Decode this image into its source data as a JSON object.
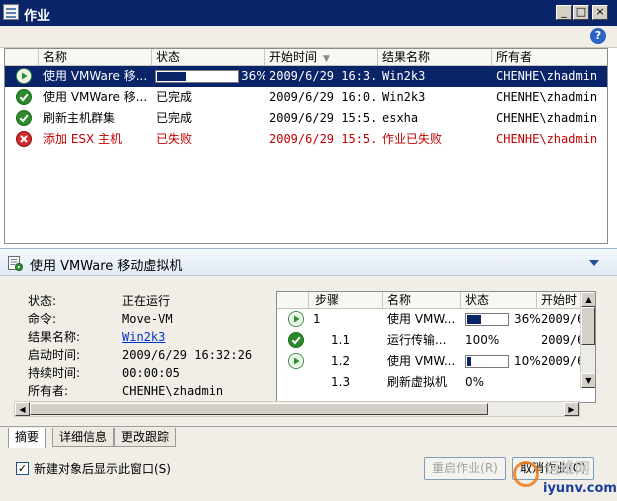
{
  "window": {
    "title": "作业",
    "controls": [
      "_",
      "□",
      "×"
    ]
  },
  "help_icon": "?",
  "job_list": {
    "columns": [
      "名称",
      "状态",
      "开始时间",
      "结果名称",
      "所有者"
    ],
    "rows": [
      {
        "icon": "running",
        "name": "使用 VMWare 移...",
        "status": "",
        "progress": "36%",
        "progress_fraction": 0.36,
        "start": "2009/6/29 16:3...",
        "result": "Win2k3",
        "owner": "CHENHE\\zhadmin"
      },
      {
        "icon": "ok",
        "name": "使用 VMWare 移...",
        "status": "已完成",
        "start": "2009/6/29 16:0...",
        "result": "Win2k3",
        "owner": "CHENHE\\zhadmin"
      },
      {
        "icon": "ok",
        "name": "刷新主机群集",
        "status": "已完成",
        "start": "2009/6/29 15:5...",
        "result": "esxha",
        "owner": "CHENHE\\zhadmin"
      },
      {
        "icon": "error",
        "name": "添加 ESX 主机",
        "status": "已失败",
        "start": "2009/6/29 15:5...",
        "result": "作业已失败",
        "owner": "CHENHE\\zhadmin"
      }
    ]
  },
  "detail": {
    "title": "使用 VMWare 移动虚拟机",
    "fields": [
      {
        "label": "状态:",
        "value": "正在运行"
      },
      {
        "label": "命令:",
        "value": "Move-VM"
      },
      {
        "label": "结果名称:",
        "value": "Win2k3"
      },
      {
        "label": "启动时间:",
        "value": "2009/6/29 16:32:26"
      },
      {
        "label": "持续时间:",
        "value": "00:00:05"
      },
      {
        "label": "所有者:",
        "value": "CHENHE\\zhadmin"
      }
    ],
    "steps": {
      "columns": [
        "步骤",
        "名称",
        "状态",
        "开始时"
      ],
      "rows": [
        {
          "icon": "running",
          "step": "1",
          "name": "使用 VMW...",
          "status": "36%",
          "progress_fraction": 0.36,
          "start": "2009/6,"
        },
        {
          "icon": "ok",
          "step": "1.1",
          "name": "运行传输...",
          "status": "100%",
          "start": "2009/6,"
        },
        {
          "icon": "running",
          "step": "1.2",
          "name": "使用 VMW...",
          "status": "10%",
          "progress_fraction": 0.1,
          "start": "2009/6,"
        },
        {
          "icon": "none",
          "step": "1.3",
          "name": "刷新虚拟机",
          "status": "0%",
          "start": ""
        }
      ]
    }
  },
  "tabs": [
    "摘要",
    "详细信息",
    "更改跟踪"
  ],
  "bottom": {
    "checkbox_label": "新建对象后显示此窗口(S)",
    "checkbox_checked": true,
    "restart_button": "重启作业(R)",
    "cancel_button": "取消作业(C)"
  },
  "watermark": {
    "line1": "运维网",
    "line2": "iyunv.com"
  },
  "colors": {
    "selection": "#0a246a",
    "error": "#c00000",
    "link": "#0033cc"
  }
}
